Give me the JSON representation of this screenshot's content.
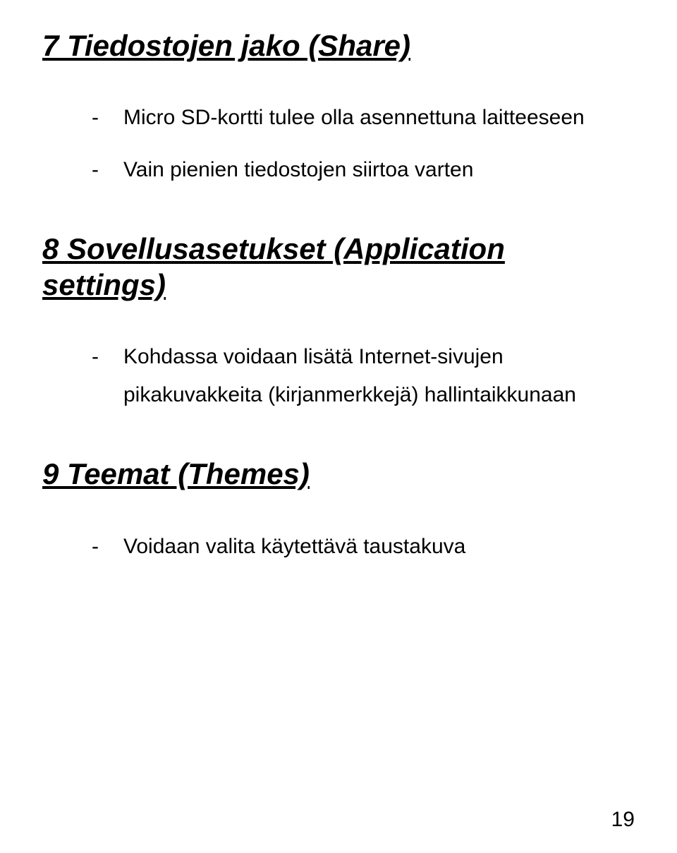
{
  "sections": [
    {
      "heading": "7 Tiedostojen jako (Share)",
      "bullets": [
        "Micro SD-kortti tulee olla asennettuna laitteeseen",
        "Vain pienien tiedostojen siirtoa varten"
      ]
    },
    {
      "heading": "8 Sovellusasetukset (Application settings)",
      "bullets": [
        "Kohdassa voidaan lisätä Internet-sivujen pikakuvakkeita (kirjanmerkkejä)  hallintaikkunaan"
      ]
    },
    {
      "heading": "9 Teemat (Themes)",
      "bullets": [
        "Voidaan valita käytettävä taustakuva"
      ]
    }
  ],
  "pageNumber": "19"
}
